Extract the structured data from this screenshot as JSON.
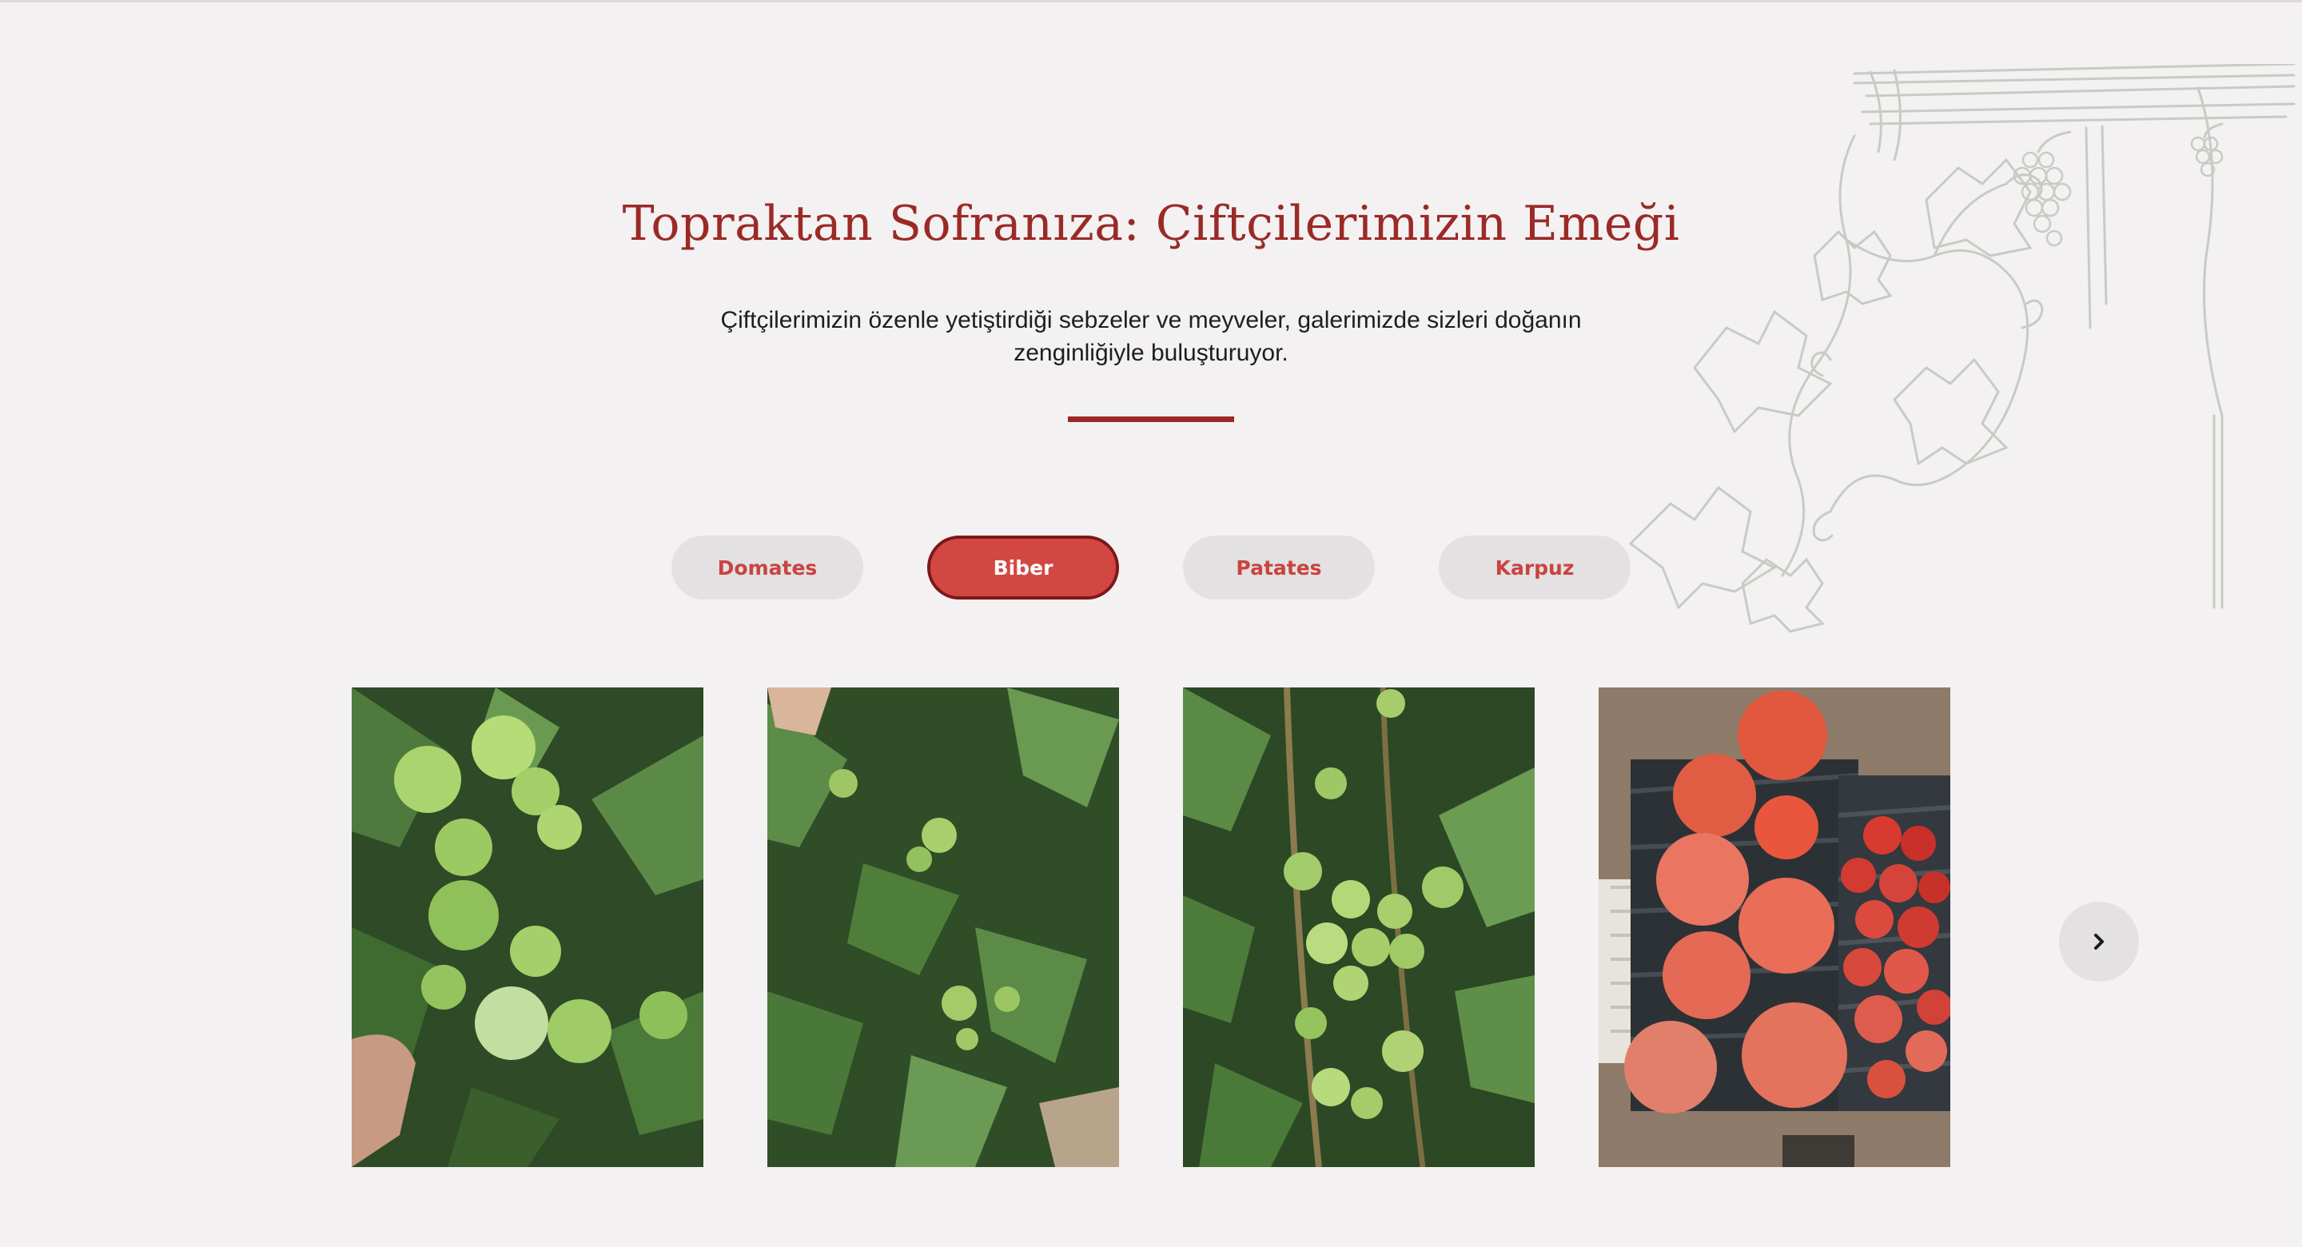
{
  "hero": {
    "title": "Topraktan Sofranıza: Çiftçilerimizin Emeği",
    "description": "Çiftçilerimizin özenle yetiştirdiği sebzeler ve meyveler, galerimizde sizleri doğanın zenginliğiyle buluşturuyor."
  },
  "tabs": [
    {
      "label": "Domates",
      "active": false
    },
    {
      "label": "Biber",
      "active": true
    },
    {
      "label": "Patates",
      "active": false
    },
    {
      "label": "Karpuz",
      "active": false
    }
  ],
  "gallery": {
    "photos": [
      {
        "subject": "green tomatoes on plant"
      },
      {
        "subject": "tomato plants foliage"
      },
      {
        "subject": "green tomato cluster"
      },
      {
        "subject": "red tomatoes in crates"
      }
    ],
    "next_icon": "chevron-right-icon"
  },
  "colors": {
    "accent": "#9b2a27",
    "tab_active_bg": "#d34743",
    "tab_active_border": "#7a1918",
    "tab_inactive_bg": "#e3e1e2",
    "tab_inactive_text": "#c94340",
    "page_bg": "#f3f1f2"
  }
}
